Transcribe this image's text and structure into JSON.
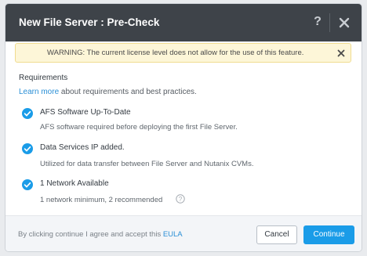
{
  "dialog": {
    "title": "New File Server : Pre-Check",
    "help_icon": "help-icon",
    "close_icon": "close-icon"
  },
  "warning": {
    "text": "WARNING: The current license level does not allow for the use of this feature.",
    "close_icon": "close-icon",
    "color": "#fdf6d8"
  },
  "requirements": {
    "heading": "Requirements",
    "learn_more_link": "Learn more",
    "learn_more_suffix": " about requirements and best practices.",
    "items": [
      {
        "title": "AFS Software Up-To-Date",
        "description": "AFS software required before deploying the first File Server.",
        "icon": "check-circle-icon"
      },
      {
        "title": "Data Services IP added.",
        "description": "Utilized for data transfer between File Server and Nutanix CVMs.",
        "icon": "check-circle-icon"
      },
      {
        "title": "1 Network Available",
        "description": "1 network minimum, 2 recommended",
        "icon": "check-circle-icon"
      }
    ],
    "info_icon": "question-circle-icon"
  },
  "footer": {
    "text": "By clicking continue I agree and accept this ",
    "eula_link": "EULA",
    "cancel_label": "Cancel",
    "continue_label": "Continue"
  },
  "colors": {
    "accent": "#1a9ce8",
    "header": "#3e4349",
    "check": "#1a9ce8"
  }
}
